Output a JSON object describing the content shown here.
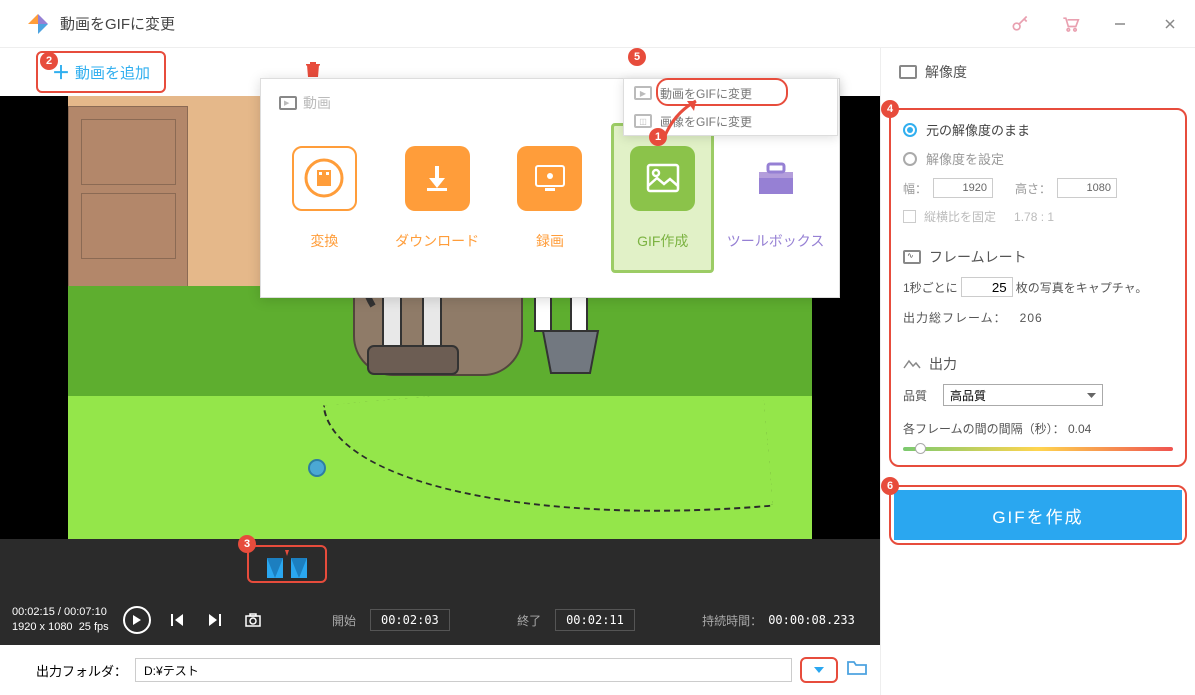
{
  "window": {
    "title": "動画をGIFに変更"
  },
  "toolbar": {
    "add_video": "動画を追加"
  },
  "menu": {
    "item1": "動画をGIFに変更",
    "item2": "画像をGIFに変更"
  },
  "popup": {
    "header": "動画",
    "tiles": {
      "convert": "変換",
      "download": "ダウンロード",
      "record": "録画",
      "gif": "GIF作成",
      "toolbox": "ツールボックス"
    }
  },
  "controls": {
    "current": "00:02:15",
    "total": "00:07:10",
    "dims": "1920 x 1080",
    "fps": "25 fps",
    "start_label": "開始",
    "start_time": "00:02:03",
    "end_label": "終了",
    "end_time": "00:02:11",
    "duration_label": "持続時間：",
    "duration": "00:00:08.233"
  },
  "output": {
    "label": "出力フォルダ：",
    "path": "D:¥テスト"
  },
  "panel": {
    "resolution_title": "解像度",
    "keep_original": "元の解像度のまま",
    "set_resolution": "解像度を設定",
    "width_label": "幅：",
    "width": "1920",
    "height_label": "高さ：",
    "height": "1080",
    "lock_aspect": "縦横比を固定",
    "aspect": "1.78 : 1",
    "framerate_title": "フレームレート",
    "fps_prefix": "1秒ごとに",
    "fps_value": "25",
    "fps_suffix": "枚の写真をキャプチャ。",
    "total_frames_label": "出力総フレーム：",
    "total_frames": "206",
    "output_title": "出力",
    "quality_label": "品質",
    "quality_value": "高品質",
    "interval_label": "各フレームの間の間隔（秒）：",
    "interval_value": "0.04",
    "create_button": "GIFを作成"
  },
  "badges": {
    "b1": "1",
    "b2": "2",
    "b3": "3",
    "b4": "4",
    "b5": "5",
    "b6": "6"
  }
}
